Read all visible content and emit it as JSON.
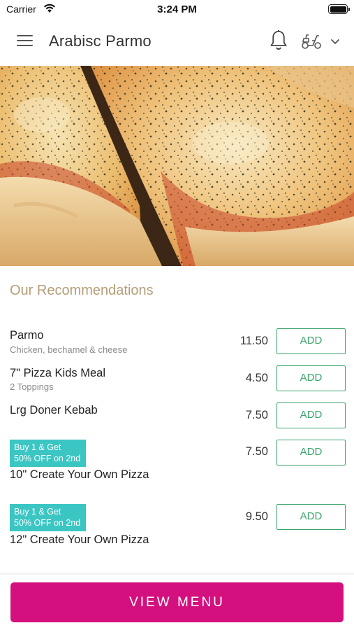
{
  "status_bar": {
    "carrier": "Carrier",
    "time": "3:24 PM"
  },
  "header": {
    "title": "Arabisc Parmo",
    "icons": {
      "menu": "hamburger-menu-icon",
      "notifications": "bell-icon",
      "order_type": "scooter-icon",
      "dropdown": "chevron-down-icon"
    }
  },
  "recommendations": {
    "title": "Our Recommendations",
    "items": [
      {
        "name": "Parmo",
        "description": "Chicken, bechamel & cheese",
        "price": "11.50",
        "add_label": "ADD"
      },
      {
        "name": "7\" Pizza Kids Meal",
        "description": "2 Toppings",
        "price": "4.50",
        "add_label": "ADD"
      },
      {
        "name": "Lrg Doner Kebab",
        "price": "7.50",
        "add_label": "ADD"
      },
      {
        "name": "10\" Create Your Own Pizza",
        "promo_line1": "Buy 1 & Get",
        "promo_line2": "50% OFF on 2nd",
        "price": "7.50",
        "add_label": "ADD"
      },
      {
        "name": "12\" Create Your Own Pizza",
        "promo_line1": "Buy 1 & Get",
        "promo_line2": "50% OFF on 2nd",
        "price": "9.50",
        "add_label": "ADD"
      }
    ]
  },
  "footer": {
    "view_menu_label": "VIEW MENU"
  },
  "colors": {
    "accent": "#d4107f",
    "add_green": "#3aa56a",
    "promo_teal": "#3cc6c3",
    "section_title": "#b59d78"
  }
}
